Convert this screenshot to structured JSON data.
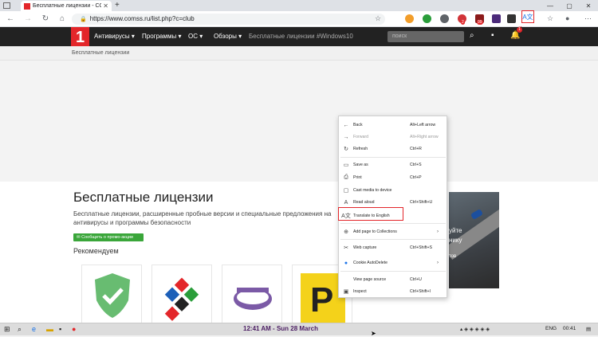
{
  "browser": {
    "tab_title": "Бесплатные лицензии - COMSS",
    "tab_close": "✕",
    "new_tab": "+",
    "url": "https://www.comss.ru/list.php?c=club",
    "win_min": "—",
    "win_max": "▢",
    "win_close": "✕",
    "back": "←",
    "forward": "→",
    "reload": "↻",
    "home": "⌂",
    "ext_badge_1": "2",
    "ext_badge_2": "99",
    "translate_badge": "1",
    "translate_glyph": "A文"
  },
  "site": {
    "logo": "1",
    "nav": [
      {
        "label": "Антивирусы ▾"
      },
      {
        "label": "Программы ▾"
      },
      {
        "label": "ОС ▾"
      },
      {
        "label": "Обзоры ▾"
      },
      {
        "label": "Бесплатные лицензии"
      },
      {
        "label": "#Windows10"
      }
    ],
    "search_placeholder": "поиск",
    "breadcrumb": "Бесплатные лицензии",
    "notif_count": "1"
  },
  "page": {
    "title": "Бесплатные лицензии",
    "description": "Бесплатные лицензии, расширенные пробные версии и специальные предложения на антивирусы и программы безопасности",
    "promo_button": "✉ Сообщить о промо-акции",
    "recommend": "Рекомендуем",
    "banner_lines": [
      "уйте",
      "нику",
      "тов"
    ]
  },
  "context_menu": {
    "items": [
      {
        "icon": "←",
        "label": "Back",
        "shortcut": "Alt+Left arrow"
      },
      {
        "icon": "→",
        "label": "Forward",
        "shortcut": "Alt+Right arrow"
      },
      {
        "icon": "↻",
        "label": "Refresh",
        "shortcut": "Ctrl+R"
      },
      {
        "icon": "▭",
        "label": "Save as",
        "shortcut": "Ctrl+S"
      },
      {
        "icon": "⎙",
        "label": "Print",
        "shortcut": "Ctrl+P"
      },
      {
        "icon": "▢",
        "label": "Cast media to device",
        "shortcut": ""
      },
      {
        "icon": "A",
        "label": "Read aloud",
        "shortcut": "Ctrl+Shift+U"
      },
      {
        "icon": "A文",
        "label": "Translate to English",
        "shortcut": ""
      },
      {
        "icon": "⊕",
        "label": "Add page to Collections",
        "shortcut": ""
      },
      {
        "icon": "✂",
        "label": "Web capture",
        "shortcut": "Ctrl+Shift+S"
      },
      {
        "icon": "●",
        "label": "Cookie AutoDelete",
        "shortcut": ""
      },
      {
        "icon": "",
        "label": "View page source",
        "shortcut": "Ctrl+U"
      },
      {
        "icon": "▣",
        "label": "Inspect",
        "shortcut": "Ctrl+Shift+I"
      }
    ],
    "submenu_arrow": "›"
  },
  "taskbar": {
    "clock_banner": "12:41 AM - Sun 28 March",
    "lang": "ENG",
    "time": "00:41",
    "start": "⊞",
    "search": "⌕"
  },
  "colors": {
    "brand_red": "#e3262a",
    "header_dark": "#222222",
    "promo_green": "#3aa63a"
  }
}
